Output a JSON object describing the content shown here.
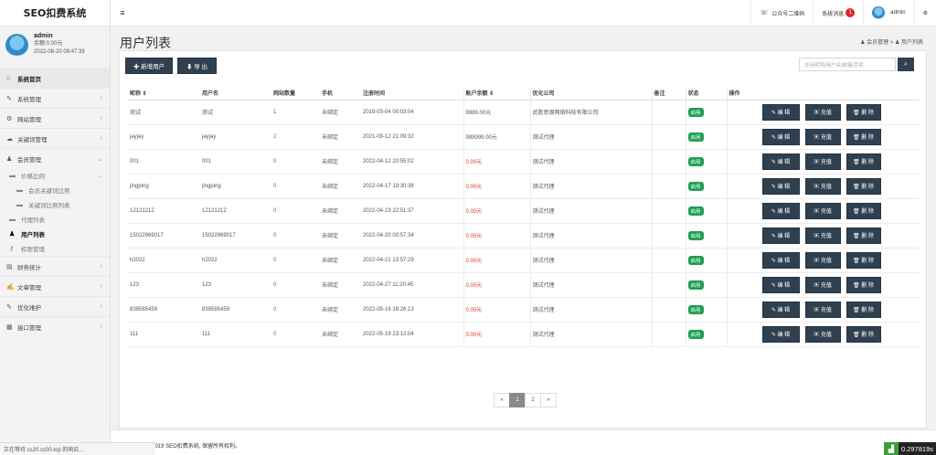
{
  "app": {
    "brand": "SEO扣费系统"
  },
  "sidebar": {
    "user": {
      "name": "admin",
      "balance": "余额:0.00元",
      "datetime": "2022-08-20 09:47:39"
    },
    "items": [
      {
        "label": "系统首页",
        "icon": "home-icon",
        "glyph": "⌂"
      },
      {
        "label": "系统管理",
        "icon": "wrench-icon",
        "glyph": "✎"
      },
      {
        "label": "网站管理",
        "icon": "gear-icon",
        "glyph": "⚙"
      },
      {
        "label": "关键词管理",
        "icon": "cloud-icon",
        "glyph": "☁"
      },
      {
        "label": "会员管理",
        "icon": "users-icon",
        "glyph": "♟"
      }
    ],
    "subitems": [
      {
        "label": "价格比例",
        "icon": "list-icon"
      },
      {
        "label": "会员关键词比例",
        "icon": "list-icon"
      },
      {
        "label": "关键词比例列表",
        "icon": "list-icon"
      },
      {
        "label": "代理列表",
        "icon": "list-icon"
      },
      {
        "label": "用户列表",
        "icon": "user-icon"
      },
      {
        "label": "权限管理",
        "icon": "key-icon"
      }
    ],
    "items2": [
      {
        "label": "财务统计",
        "icon": "money-icon",
        "glyph": "▤"
      },
      {
        "label": "文章管理",
        "icon": "edit-icon",
        "glyph": "✍"
      },
      {
        "label": "优化维护",
        "icon": "wrench-icon",
        "glyph": "✎"
      },
      {
        "label": "接口管理",
        "icon": "table-icon",
        "glyph": "▦"
      }
    ]
  },
  "header": {
    "menu_icon": "≡",
    "qrcode": "公众号二维码",
    "messages": "系统消息",
    "message_count": "1",
    "user": "admin",
    "settings_icon": "⚙"
  },
  "page": {
    "title": "用户列表",
    "breadcrumb": "会员管理 > ♟ 用户列表",
    "add_button": "✚ 新增用户",
    "export_button": "⬇ 导 出",
    "search_placeholder": "支持昵称|用户名|邮箱|手机"
  },
  "table": {
    "headers": [
      "昵称 ⇕",
      "用户名",
      "网站数量",
      "手机",
      "注册时间",
      "账户余额 ⇕",
      "优化公司",
      "备注",
      "状态",
      "操作"
    ],
    "rows": [
      {
        "nick": "测试",
        "user": "测试",
        "sites": "1",
        "phone": "未绑定",
        "time": "2019-03-04 00:03:04",
        "balance": "9988.00元",
        "company": "武胜思源网络科技有限公司",
        "note": "",
        "status": "启用",
        "balance_red": false,
        "sites_blue": true
      },
      {
        "nick": "jayjay",
        "user": "jayjay",
        "sites": "2",
        "phone": "未绑定",
        "time": "2021-09-12 21:09:32",
        "balance": "999999.00元",
        "company": "测试代理",
        "note": "",
        "status": "启用",
        "balance_red": false,
        "sites_blue": true
      },
      {
        "nick": "001",
        "user": "001",
        "sites": "0",
        "phone": "未绑定",
        "time": "2022-04-12 20:55:02",
        "balance": "0.00元",
        "company": "测试代理",
        "note": "",
        "status": "启用",
        "balance_red": true,
        "sites_blue": true
      },
      {
        "nick": "jingping",
        "user": "jingping",
        "sites": "0",
        "phone": "未绑定",
        "time": "2022-04-17 19:30:38",
        "balance": "0.00元",
        "company": "测试代理",
        "note": "",
        "status": "启用",
        "balance_red": true,
        "sites_blue": true
      },
      {
        "nick": "12121212",
        "user": "12121212",
        "sites": "0",
        "phone": "未绑定",
        "time": "2022-04-19 22:51:37",
        "balance": "0.00元",
        "company": "测试代理",
        "note": "",
        "status": "启用",
        "balance_red": true,
        "sites_blue": true
      },
      {
        "nick": "15022969017",
        "user": "15022969017",
        "sites": "0",
        "phone": "未绑定",
        "time": "2022-04-20 00:57:34",
        "balance": "0.00元",
        "company": "测试代理",
        "note": "",
        "status": "启用",
        "balance_red": true,
        "sites_blue": true
      },
      {
        "nick": "h2022",
        "user": "h2022",
        "sites": "0",
        "phone": "未绑定",
        "time": "2022-04-21 13:57:29",
        "balance": "0.00元",
        "company": "测试代理",
        "note": "",
        "status": "启用",
        "balance_red": true,
        "sites_blue": true
      },
      {
        "nick": "123",
        "user": "123",
        "sites": "0",
        "phone": "未绑定",
        "time": "2022-04-27 11:20:45",
        "balance": "0.00元",
        "company": "测试代理",
        "note": "",
        "status": "启用",
        "balance_red": true,
        "sites_blue": true
      },
      {
        "nick": "839585459",
        "user": "839585459",
        "sites": "0",
        "phone": "未绑定",
        "time": "2022-05-16 16:26:13",
        "balance": "0.00元",
        "company": "测试代理",
        "note": "",
        "status": "启用",
        "balance_red": true,
        "sites_blue": true
      },
      {
        "nick": "111",
        "user": "111",
        "sites": "0",
        "phone": "未绑定",
        "time": "2022-05-19 23:12:04",
        "balance": "0.00元",
        "company": "测试代理",
        "note": "",
        "status": "启用",
        "balance_red": true,
        "sites_blue": true
      }
    ],
    "actions": {
      "edit": "✎ 编 辑",
      "recharge": "▣ 充值",
      "delete": "🗑 删 除"
    }
  },
  "pagination": {
    "prev": "«",
    "pages": [
      "1",
      "2"
    ],
    "current": "1",
    "next": "»"
  },
  "footer": {
    "copyright": "版权©2014 - 2019 SEO扣费系统, 保留所有权利。"
  },
  "statusbar": {
    "text": "正在等待 cs20.xz00.top 的响应...",
    "perf_value": "0.297819s"
  },
  "colors": {
    "dark": "#2f4050",
    "green": "#1e9e55",
    "red": "#e0322c",
    "blue": "#2a7ac9"
  }
}
